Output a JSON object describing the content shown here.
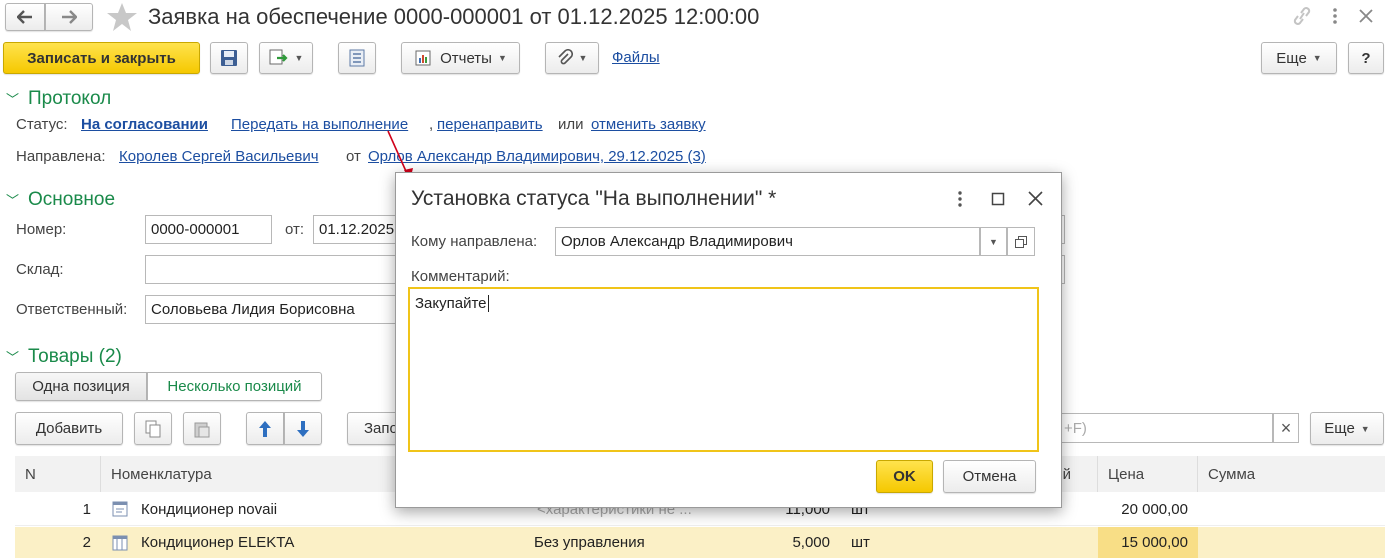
{
  "window": {
    "title": "Заявка на обеспечение 0000-000001 от 01.12.2025 12:00:00"
  },
  "toolbar": {
    "save_close": "Записать и закрыть",
    "reports": "Отчеты",
    "files": "Файлы",
    "more": "Еще",
    "help": "?"
  },
  "protocol": {
    "header": "Протокол",
    "status_label": "Статус:",
    "status_value": "На согласовании",
    "action_send": "Передать на выполнение",
    "comma": ",",
    "action_redirect": "перенаправить",
    "or": "или",
    "action_cancel": "отменить заявку",
    "directed_label": "Направлена:",
    "directed_to": "Королев Сергей Васильевич",
    "from_word": "от",
    "directed_from": "Орлов Александр Владимирович, 29.12.2025 (3)"
  },
  "main": {
    "header": "Основное",
    "number_label": "Номер:",
    "number_value": "0000-000001",
    "date_label": "от:",
    "date_value": "01.12.2025",
    "warehouse_label": "Склад:",
    "warehouse_value": "",
    "responsible_label": "Ответственный:",
    "responsible_value": "Соловьева Лидия Борисовна"
  },
  "goods": {
    "header": "Товары (2)",
    "tab_one": "Одна позиция",
    "tab_many": "Несколько позиций",
    "add": "Добавить",
    "fill_partial": "Запо",
    "search_partial": "+F)",
    "clear": "×",
    "more": "Еще",
    "columns": {
      "n": "N",
      "nomenclature": "Номенклатура",
      "qty_partial": "й",
      "price": "Цена",
      "sum": "Сумма"
    },
    "rows": [
      {
        "n": "1",
        "name": "Кондиционер novaii",
        "characteristic": "<характеристики не ...",
        "qty": "11,000",
        "unit": "шт",
        "price": "20 000,00",
        "sum": ""
      },
      {
        "n": "2",
        "name": "Кондиционер ELEKTA",
        "characteristic": "Без управления",
        "qty": "5,000",
        "unit": "шт",
        "price": "15 000,00",
        "sum": ""
      }
    ]
  },
  "dialog": {
    "title": "Установка статуса \"На выполнении\" *",
    "to_label": "Кому направлена:",
    "to_value": "Орлов Александр Владимирович",
    "comment_label": "Комментарий:",
    "comment_value": "Закупайте",
    "ok": "OK",
    "cancel": "Отмена"
  },
  "colors": {
    "accent_yellow": "#f5c800",
    "section_green": "#1a8a4a",
    "link_blue": "#1c4ea1",
    "selected_row": "#fbf0c6",
    "arrow_red": "#d0021b"
  }
}
